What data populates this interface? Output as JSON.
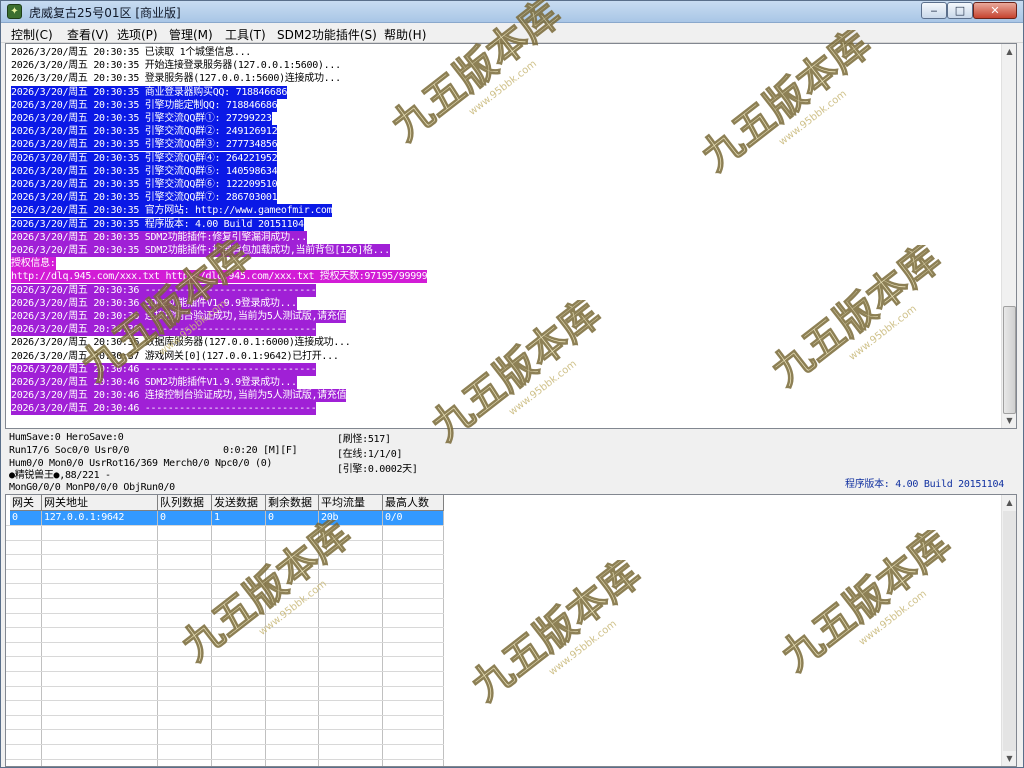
{
  "window": {
    "title": "虎威复古25号01区 [商业版]",
    "icon": "app-icon",
    "controls": {
      "minimize": "‒",
      "maximize": "□",
      "close": "✕"
    }
  },
  "menu": [
    {
      "label": "控制(C)"
    },
    {
      "label": "查看(V)"
    },
    {
      "label": "选项(P)"
    },
    {
      "label": "管理(M)"
    },
    {
      "label": "工具(T)"
    },
    {
      "label": "SDM2功能插件(S)"
    },
    {
      "label": "帮助(H)"
    }
  ],
  "log": [
    {
      "text": "2026/3/20/周五 20:30:35 已读取 1个城堡信息...",
      "style": "none"
    },
    {
      "text": "2026/3/20/周五 20:30:35 开始连接登录服务器(127.0.0.1:5600)...",
      "style": "none"
    },
    {
      "text": "2026/3/20/周五 20:30:35 登录服务器(127.0.0.1:5600)连接成功...",
      "style": "none"
    },
    {
      "text": "2026/3/20/周五 20:30:35 商业登录器购买QQ: 718846686",
      "style": "blue"
    },
    {
      "text": "2026/3/20/周五 20:30:35 引擎功能定制QQ: 718846686",
      "style": "blue"
    },
    {
      "text": "2026/3/20/周五 20:30:35 引擎交流QQ群①: 27299223",
      "style": "blue"
    },
    {
      "text": "2026/3/20/周五 20:30:35 引擎交流QQ群②: 249126912",
      "style": "blue"
    },
    {
      "text": "2026/3/20/周五 20:30:35 引擎交流QQ群③: 277734856",
      "style": "blue"
    },
    {
      "text": "2026/3/20/周五 20:30:35 引擎交流QQ群④: 264221952",
      "style": "blue"
    },
    {
      "text": "2026/3/20/周五 20:30:35 引擎交流QQ群⑤: 140598634",
      "style": "blue"
    },
    {
      "text": "2026/3/20/周五 20:30:35 引擎交流QQ群⑥: 122209510",
      "style": "blue"
    },
    {
      "text": "2026/3/20/周五 20:30:35 引擎交流QQ群⑦: 286703001",
      "style": "blue"
    },
    {
      "text": "2026/3/20/周五 20:30:35 官方网站: http://www.gameofmir.com",
      "style": "blue"
    },
    {
      "text": "2026/3/20/周五 20:30:35 程序版本: 4.00 Build 20151104",
      "style": "blue"
    },
    {
      "text": "2026/3/20/周五 20:30:35 SDM2功能插件:修复引擎漏洞成功...",
      "style": "purple"
    },
    {
      "text": "2026/3/20/周五 20:30:35 SDM2功能插件:扩展背包加载成功,当前背包[126]格...",
      "style": "purple"
    },
    {
      "text": "授权信息:",
      "style": "magenta"
    },
    {
      "text": "http://dlq.945.com/xxx.txt http://dlq.945.com/xxx.txt 授权天数:97195/99999",
      "style": "magenta"
    },
    {
      "text": "2026/3/20/周五 20:30:36 ------------------------------",
      "style": "purple"
    },
    {
      "text": "2026/3/20/周五 20:30:36 SDM2功能插件V1.9.9登录成功...",
      "style": "purple"
    },
    {
      "text": "2026/3/20/周五 20:30:36 连接控制台验证成功,当前为5人测试版,请充值",
      "style": "purple"
    },
    {
      "text": "2026/3/20/周五 20:30:36 ------------------------------",
      "style": "purple"
    },
    {
      "text": "2026/3/20/周五 20:30:36 数据库服务器(127.0.0.1:6000)连接成功...",
      "style": "none"
    },
    {
      "text": "2026/3/20/周五 20:30:37 游戏网关[0](127.0.0.1:9642)已打开...",
      "style": "none"
    },
    {
      "text": "2026/3/20/周五 20:30:46 ------------------------------",
      "style": "purple"
    },
    {
      "text": "2026/3/20/周五 20:30:46 SDM2功能插件V1.9.9登录成功...",
      "style": "purple"
    },
    {
      "text": "2026/3/20/周五 20:30:46 连接控制台验证成功,当前为5人测试版,请充值",
      "style": "purple"
    },
    {
      "text": "2026/3/20/周五 20:30:46 ------------------------------",
      "style": "purple"
    }
  ],
  "status": {
    "line1": "HumSave:0 HeroSave:0",
    "line2": "Run17/6 Soc0/0 Usr0/0",
    "timer": "0:0:20 [M][F]",
    "line3": "Hum0/0 Mon0/0 UsrRot16/369 Merch0/0 Npc0/0 (0)",
    "line4": "●精锐兽王●,88/221 -",
    "line5": "MonG0/0/0 MonP0/0/0 ObjRun0/0",
    "refresh": "[刷怪:517]",
    "online": "[在线:1/1/0]",
    "engine": "[引擎:0.0002天]",
    "version": "程序版本: 4.00 Build 20151104"
  },
  "grid": {
    "columns": [
      "网关",
      "网关地址",
      "队列数据",
      "发送数据",
      "剩余数据",
      "平均流量",
      "最高人数"
    ],
    "rows": [
      [
        "0",
        "127.0.0.1:9642",
        "0",
        "1",
        "0",
        "20b",
        "0/0"
      ]
    ]
  },
  "watermark": {
    "brand": "九五版本库",
    "site": "www.95bbk.com"
  },
  "colors": {
    "blue_highlight": "#0a19e6",
    "purple_highlight": "#a020d6",
    "magenta_highlight": "#d21cd6",
    "selection": "#3399ff"
  }
}
